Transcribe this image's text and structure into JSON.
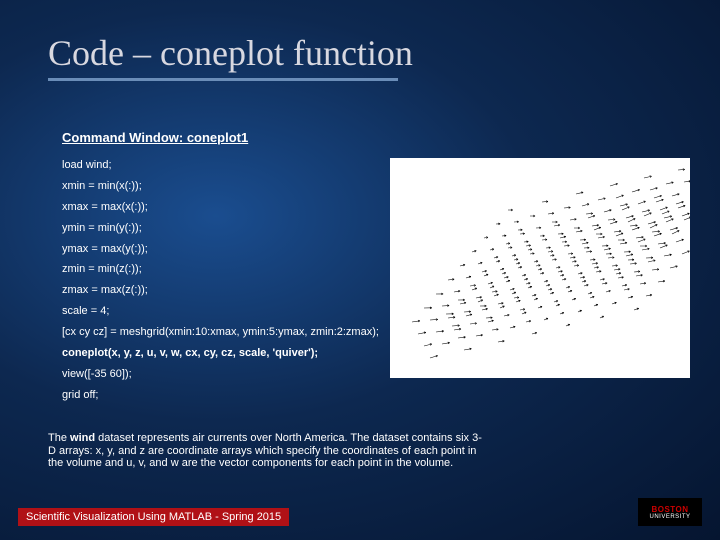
{
  "title": "Code – coneplot function",
  "subtitle": "Command Window: coneplot1",
  "code": [
    "load wind;",
    "xmin = min(x(:));",
    "xmax = max(x(:));",
    "ymin = min(y(:));",
    "ymax = max(y(:));",
    "zmin = min(z(:));",
    "zmax = max(z(:));",
    "scale = 4;",
    "[cx cy cz] = meshgrid(xmin:10:xmax, ymin:5:ymax, zmin:2:zmax);",
    "coneplot(x, y, z, u, v, w, cx, cy, cz, scale, 'quiver');",
    "view([-35 60]);",
    "grid off;"
  ],
  "bold_lines": [
    9
  ],
  "desc_prefix": "The ",
  "desc_bold": "wind",
  "desc_rest": " dataset represents air currents over North America. The dataset contains six 3-D arrays: x, y, and z are coordinate arrays which specify the coordinates of each point in the volume and u, v, and w are the vector components for each point in the volume.",
  "footer": "Scientific Visualization Using MATLAB - Spring 2015",
  "logo_top": "BOSTON",
  "logo_bot": "UNIVERSITY",
  "chart_data": {
    "type": "quiver",
    "title": "",
    "description": "3D quiver/cone plot of wind vector field over North America, viewed from azimuth -35 elevation 60, grid off",
    "view": [
      -35,
      60
    ],
    "x_range": [
      70,
      135
    ],
    "y_range": [
      17,
      60
    ],
    "z_range": [
      0,
      16
    ],
    "x_step": 10,
    "y_step": 5,
    "z_step": 2,
    "scale": 4,
    "series": [
      {
        "name": "wind vectors",
        "note": "dense field of small black arrows pointing predominantly eastward"
      }
    ]
  }
}
